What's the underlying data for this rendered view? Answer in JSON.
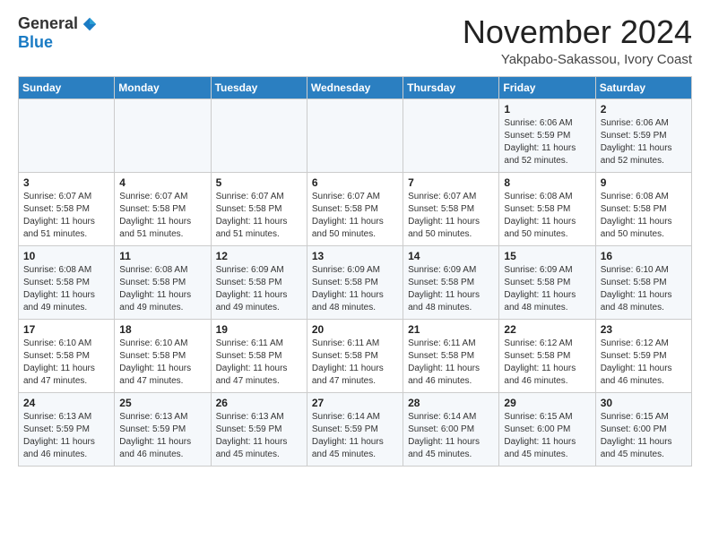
{
  "header": {
    "logo_general": "General",
    "logo_blue": "Blue",
    "month_title": "November 2024",
    "location": "Yakpabo-Sakassou, Ivory Coast"
  },
  "weekdays": [
    "Sunday",
    "Monday",
    "Tuesday",
    "Wednesday",
    "Thursday",
    "Friday",
    "Saturday"
  ],
  "weeks": [
    [
      {
        "day": "",
        "info": ""
      },
      {
        "day": "",
        "info": ""
      },
      {
        "day": "",
        "info": ""
      },
      {
        "day": "",
        "info": ""
      },
      {
        "day": "",
        "info": ""
      },
      {
        "day": "1",
        "info": "Sunrise: 6:06 AM\nSunset: 5:59 PM\nDaylight: 11 hours\nand 52 minutes."
      },
      {
        "day": "2",
        "info": "Sunrise: 6:06 AM\nSunset: 5:59 PM\nDaylight: 11 hours\nand 52 minutes."
      }
    ],
    [
      {
        "day": "3",
        "info": "Sunrise: 6:07 AM\nSunset: 5:58 PM\nDaylight: 11 hours\nand 51 minutes."
      },
      {
        "day": "4",
        "info": "Sunrise: 6:07 AM\nSunset: 5:58 PM\nDaylight: 11 hours\nand 51 minutes."
      },
      {
        "day": "5",
        "info": "Sunrise: 6:07 AM\nSunset: 5:58 PM\nDaylight: 11 hours\nand 51 minutes."
      },
      {
        "day": "6",
        "info": "Sunrise: 6:07 AM\nSunset: 5:58 PM\nDaylight: 11 hours\nand 50 minutes."
      },
      {
        "day": "7",
        "info": "Sunrise: 6:07 AM\nSunset: 5:58 PM\nDaylight: 11 hours\nand 50 minutes."
      },
      {
        "day": "8",
        "info": "Sunrise: 6:08 AM\nSunset: 5:58 PM\nDaylight: 11 hours\nand 50 minutes."
      },
      {
        "day": "9",
        "info": "Sunrise: 6:08 AM\nSunset: 5:58 PM\nDaylight: 11 hours\nand 50 minutes."
      }
    ],
    [
      {
        "day": "10",
        "info": "Sunrise: 6:08 AM\nSunset: 5:58 PM\nDaylight: 11 hours\nand 49 minutes."
      },
      {
        "day": "11",
        "info": "Sunrise: 6:08 AM\nSunset: 5:58 PM\nDaylight: 11 hours\nand 49 minutes."
      },
      {
        "day": "12",
        "info": "Sunrise: 6:09 AM\nSunset: 5:58 PM\nDaylight: 11 hours\nand 49 minutes."
      },
      {
        "day": "13",
        "info": "Sunrise: 6:09 AM\nSunset: 5:58 PM\nDaylight: 11 hours\nand 48 minutes."
      },
      {
        "day": "14",
        "info": "Sunrise: 6:09 AM\nSunset: 5:58 PM\nDaylight: 11 hours\nand 48 minutes."
      },
      {
        "day": "15",
        "info": "Sunrise: 6:09 AM\nSunset: 5:58 PM\nDaylight: 11 hours\nand 48 minutes."
      },
      {
        "day": "16",
        "info": "Sunrise: 6:10 AM\nSunset: 5:58 PM\nDaylight: 11 hours\nand 48 minutes."
      }
    ],
    [
      {
        "day": "17",
        "info": "Sunrise: 6:10 AM\nSunset: 5:58 PM\nDaylight: 11 hours\nand 47 minutes."
      },
      {
        "day": "18",
        "info": "Sunrise: 6:10 AM\nSunset: 5:58 PM\nDaylight: 11 hours\nand 47 minutes."
      },
      {
        "day": "19",
        "info": "Sunrise: 6:11 AM\nSunset: 5:58 PM\nDaylight: 11 hours\nand 47 minutes."
      },
      {
        "day": "20",
        "info": "Sunrise: 6:11 AM\nSunset: 5:58 PM\nDaylight: 11 hours\nand 47 minutes."
      },
      {
        "day": "21",
        "info": "Sunrise: 6:11 AM\nSunset: 5:58 PM\nDaylight: 11 hours\nand 46 minutes."
      },
      {
        "day": "22",
        "info": "Sunrise: 6:12 AM\nSunset: 5:58 PM\nDaylight: 11 hours\nand 46 minutes."
      },
      {
        "day": "23",
        "info": "Sunrise: 6:12 AM\nSunset: 5:59 PM\nDaylight: 11 hours\nand 46 minutes."
      }
    ],
    [
      {
        "day": "24",
        "info": "Sunrise: 6:13 AM\nSunset: 5:59 PM\nDaylight: 11 hours\nand 46 minutes."
      },
      {
        "day": "25",
        "info": "Sunrise: 6:13 AM\nSunset: 5:59 PM\nDaylight: 11 hours\nand 46 minutes."
      },
      {
        "day": "26",
        "info": "Sunrise: 6:13 AM\nSunset: 5:59 PM\nDaylight: 11 hours\nand 45 minutes."
      },
      {
        "day": "27",
        "info": "Sunrise: 6:14 AM\nSunset: 5:59 PM\nDaylight: 11 hours\nand 45 minutes."
      },
      {
        "day": "28",
        "info": "Sunrise: 6:14 AM\nSunset: 6:00 PM\nDaylight: 11 hours\nand 45 minutes."
      },
      {
        "day": "29",
        "info": "Sunrise: 6:15 AM\nSunset: 6:00 PM\nDaylight: 11 hours\nand 45 minutes."
      },
      {
        "day": "30",
        "info": "Sunrise: 6:15 AM\nSunset: 6:00 PM\nDaylight: 11 hours\nand 45 minutes."
      }
    ]
  ]
}
